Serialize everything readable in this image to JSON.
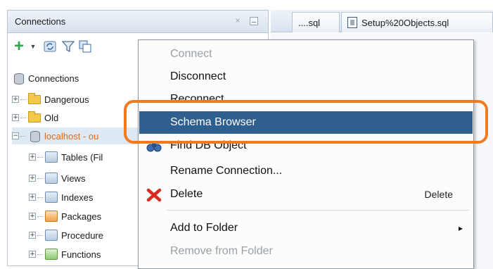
{
  "connections_panel": {
    "title": "Connections",
    "close_symbol": "×",
    "toolbar": {
      "add_icon": "plus-icon",
      "dropdown_icon": "chevron-down-icon",
      "refresh_icon": "refresh-icon",
      "filter_icon": "filter-icon",
      "copy_icon": "copy-icon"
    },
    "tree": [
      {
        "label": "Connections"
      },
      {
        "label": "Dangerous",
        "expander": "+"
      },
      {
        "label": "Old",
        "expander": "+"
      },
      {
        "label": "localhost - ou",
        "expander": "−"
      },
      {
        "label": "Tables (Fil",
        "expander": "+"
      },
      {
        "label": "Views",
        "expander": "+"
      },
      {
        "label": "Indexes",
        "expander": "+"
      },
      {
        "label": "Packages",
        "expander": "+"
      },
      {
        "label": "Procedure",
        "expander": "+"
      },
      {
        "label": "Functions",
        "expander": "+"
      }
    ]
  },
  "editor_tabs": [
    {
      "label": "....sql"
    },
    {
      "label": "Setup%20Objects.sql"
    }
  ],
  "context_menu": {
    "items": [
      {
        "label": "Connect",
        "disabled": true
      },
      {
        "label": "Disconnect"
      },
      {
        "label": "Reconnect"
      },
      {
        "label": "Schema Browser",
        "selected": true
      },
      {
        "label": "Find DB Object",
        "icon": "binoculars-icon"
      },
      {
        "label": "Rename Connection..."
      },
      {
        "label": "Delete",
        "shortcut": "Delete",
        "icon": "red-x-icon"
      },
      {
        "label": "Add to Folder",
        "submenu": "▸"
      },
      {
        "label": "Remove from Folder",
        "disabled": true
      }
    ]
  },
  "colors": {
    "highlight": "#ee7a22",
    "selection": "#2f5f8f",
    "accent_text": "#e06a14"
  }
}
